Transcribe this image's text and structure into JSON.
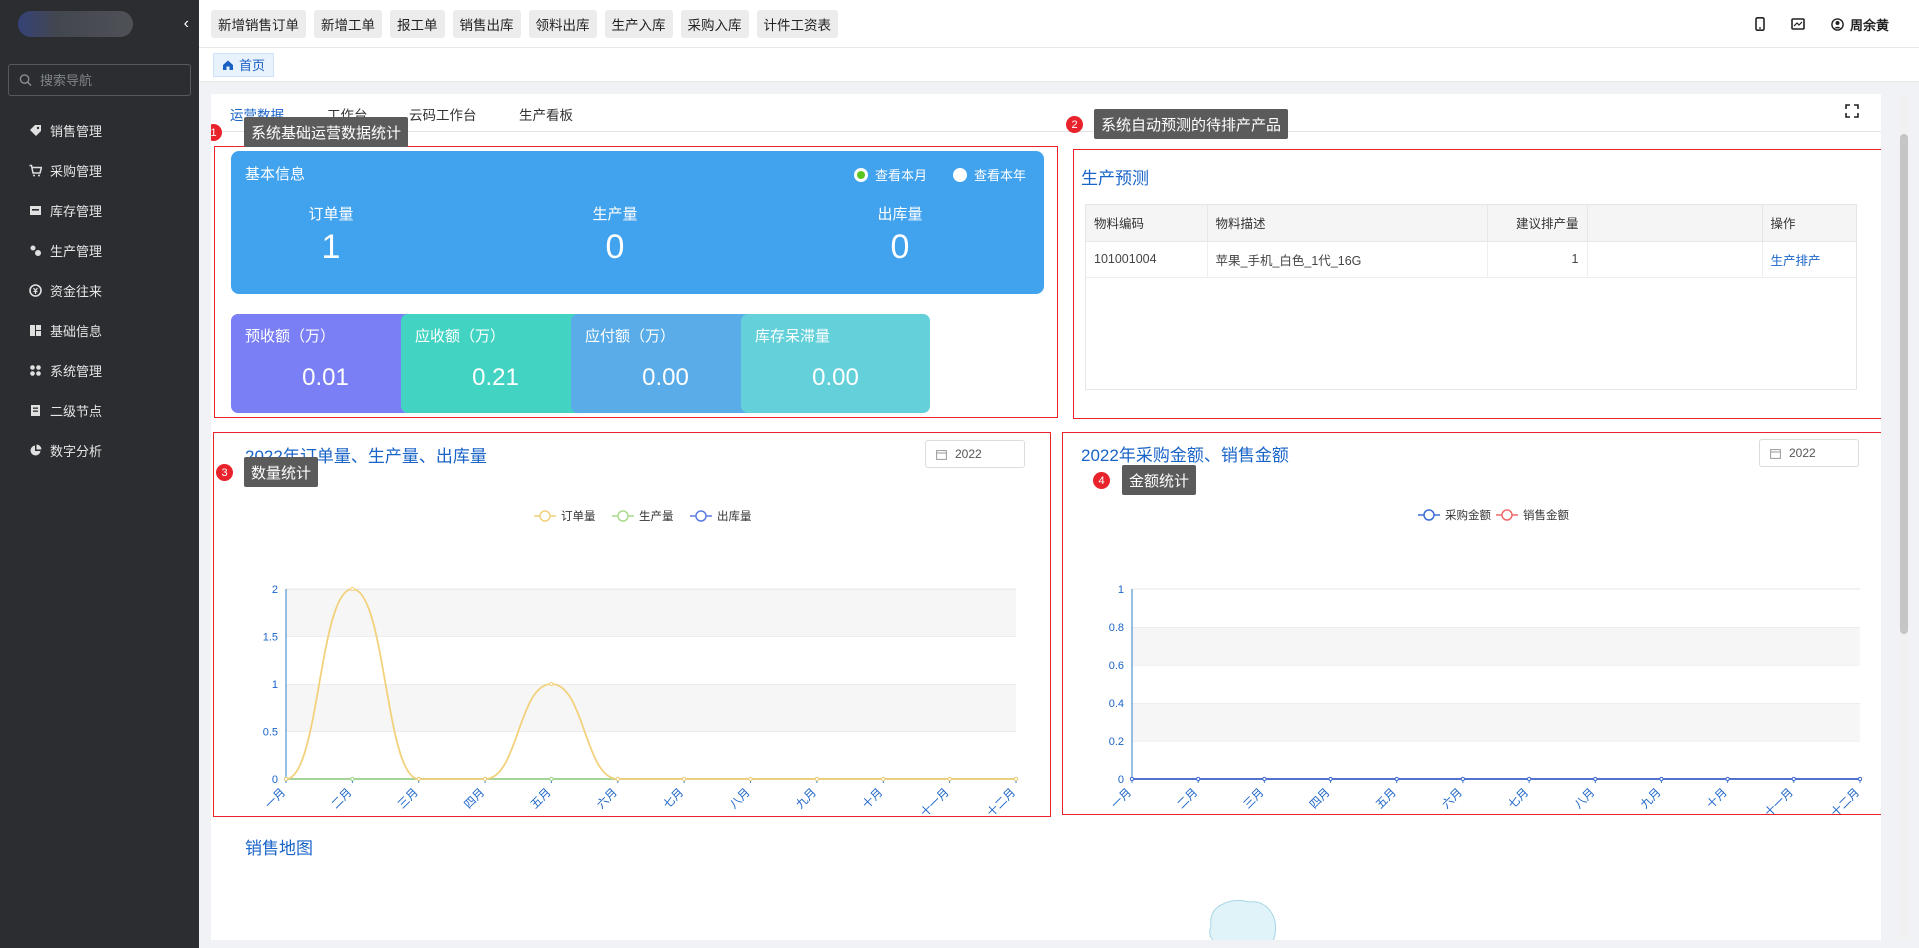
{
  "sidebar": {
    "search_placeholder": "搜索导航",
    "items": [
      {
        "label": "销售管理",
        "icon": "tag-icon"
      },
      {
        "label": "采购管理",
        "icon": "cart-icon"
      },
      {
        "label": "库存管理",
        "icon": "inbox-icon"
      },
      {
        "label": "生产管理",
        "icon": "factory-icon"
      },
      {
        "label": "资金往来",
        "icon": "money-icon"
      },
      {
        "label": "基础信息",
        "icon": "grid-icon"
      },
      {
        "label": "系统管理",
        "icon": "apps-icon"
      },
      {
        "label": "二级节点",
        "icon": "book-icon"
      },
      {
        "label": "数字分析",
        "icon": "pie-icon"
      }
    ]
  },
  "topbar": {
    "quick_buttons": [
      "新增销售订单",
      "新增工单",
      "报工单",
      "销售出库",
      "领料出库",
      "生产入库",
      "采购入库",
      "计件工资表"
    ],
    "user_name": "周余黄"
  },
  "breadcrumb": {
    "home": "首页"
  },
  "subtabs": [
    "运营数据",
    "工作台",
    "云码工作台",
    "生产看板"
  ],
  "annotations": [
    {
      "num": "1",
      "text": "系统基础运营数据统计"
    },
    {
      "num": "2",
      "text": "系统自动预测的待排产产品"
    },
    {
      "num": "3",
      "text": "数量统计"
    },
    {
      "num": "4",
      "text": "金额统计"
    }
  ],
  "basic_info": {
    "title": "基本信息",
    "radio_month": "查看本月",
    "radio_year": "查看本年",
    "metrics": [
      {
        "label": "订单量",
        "value": "1"
      },
      {
        "label": "生产量",
        "value": "0"
      },
      {
        "label": "出库量",
        "value": "0"
      }
    ],
    "cards": [
      {
        "label": "预收额（万）",
        "value": "0.01",
        "color": "#7b7ff5"
      },
      {
        "label": "应收额（万）",
        "value": "0.21",
        "color": "#43d3c2"
      },
      {
        "label": "应付额（万）",
        "value": "0.00",
        "color": "#5aace8"
      },
      {
        "label": "库存呆滞量",
        "value": "0.00",
        "color": "#63d0da"
      }
    ]
  },
  "forecast": {
    "title": "生产预测",
    "columns": [
      "物料编码",
      "物料描述",
      "建议排产量",
      "",
      "操作"
    ],
    "rows": [
      {
        "code": "101001004",
        "desc": "苹果_手机_白色_1代_16G",
        "qty": "1",
        "blank": "",
        "action": "生产排产"
      }
    ]
  },
  "year_value": "2022",
  "sales_map": {
    "title": "销售地图"
  },
  "chart_data": [
    {
      "type": "line",
      "title": "2022年订单量、生产量、出库量",
      "categories": [
        "一月",
        "二月",
        "三月",
        "四月",
        "五月",
        "六月",
        "七月",
        "八月",
        "九月",
        "十月",
        "十一月",
        "十二月"
      ],
      "series": [
        {
          "name": "订单量",
          "color": "#f2d17c",
          "values": [
            0,
            2,
            0,
            0,
            1,
            0,
            0,
            0,
            0,
            0,
            0,
            0
          ]
        },
        {
          "name": "生产量",
          "color": "#a9dc8c",
          "values": [
            0,
            0,
            0,
            0,
            0,
            0,
            0,
            0,
            0,
            0,
            0,
            0
          ]
        },
        {
          "name": "出库量",
          "color": "#5b7ee0",
          "values": [
            0,
            0,
            0,
            0,
            0,
            0,
            0,
            0,
            0,
            0,
            0,
            0
          ]
        }
      ],
      "yticks": [
        "0",
        "0.5",
        "1",
        "1.5",
        "2"
      ],
      "ylim": [
        0,
        2
      ],
      "legend": "top-center",
      "grid": true
    },
    {
      "type": "line",
      "title": "2022年采购金额、销售金额",
      "categories": [
        "一月",
        "二月",
        "三月",
        "四月",
        "五月",
        "六月",
        "七月",
        "八月",
        "九月",
        "十月",
        "十一月",
        "十二月"
      ],
      "series": [
        {
          "name": "采购金额",
          "color": "#3b6ed6",
          "values": [
            0,
            0,
            0,
            0,
            0,
            0,
            0,
            0,
            0,
            0,
            0,
            0
          ]
        },
        {
          "name": "销售金额",
          "color": "#ee6a6a",
          "values": [
            0,
            0,
            0,
            0,
            0,
            0,
            0,
            0,
            0,
            0,
            0,
            0
          ]
        }
      ],
      "yticks": [
        "0",
        "0.2",
        "0.4",
        "0.6",
        "0.8",
        "1"
      ],
      "ylim": [
        0,
        1
      ],
      "legend": "top-center",
      "grid": true
    }
  ]
}
